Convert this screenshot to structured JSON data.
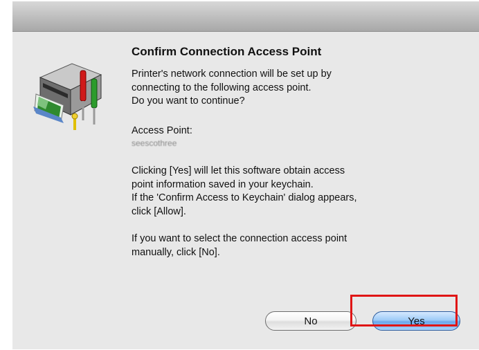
{
  "dialog": {
    "title": "Confirm Connection Access Point",
    "intro": "Printer's network connection will be set up by\nconnecting to the following access point.\nDo you want to continue?",
    "access_point_label": "Access Point:",
    "access_point_value": "seescothree",
    "keychain_message": "Clicking [Yes] will let this software obtain access\npoint information saved in your keychain.\nIf the 'Confirm Access to Keychain' dialog appears,\nclick [Allow].",
    "manual_message": "If you want to select the connection access point\nmanually, click [No].",
    "icon": "printer-setup-icon"
  },
  "buttons": {
    "no_label": "No",
    "yes_label": "Yes"
  },
  "annotation": {
    "highlight_color": "#e01515",
    "highlight_target": "yes-button"
  }
}
